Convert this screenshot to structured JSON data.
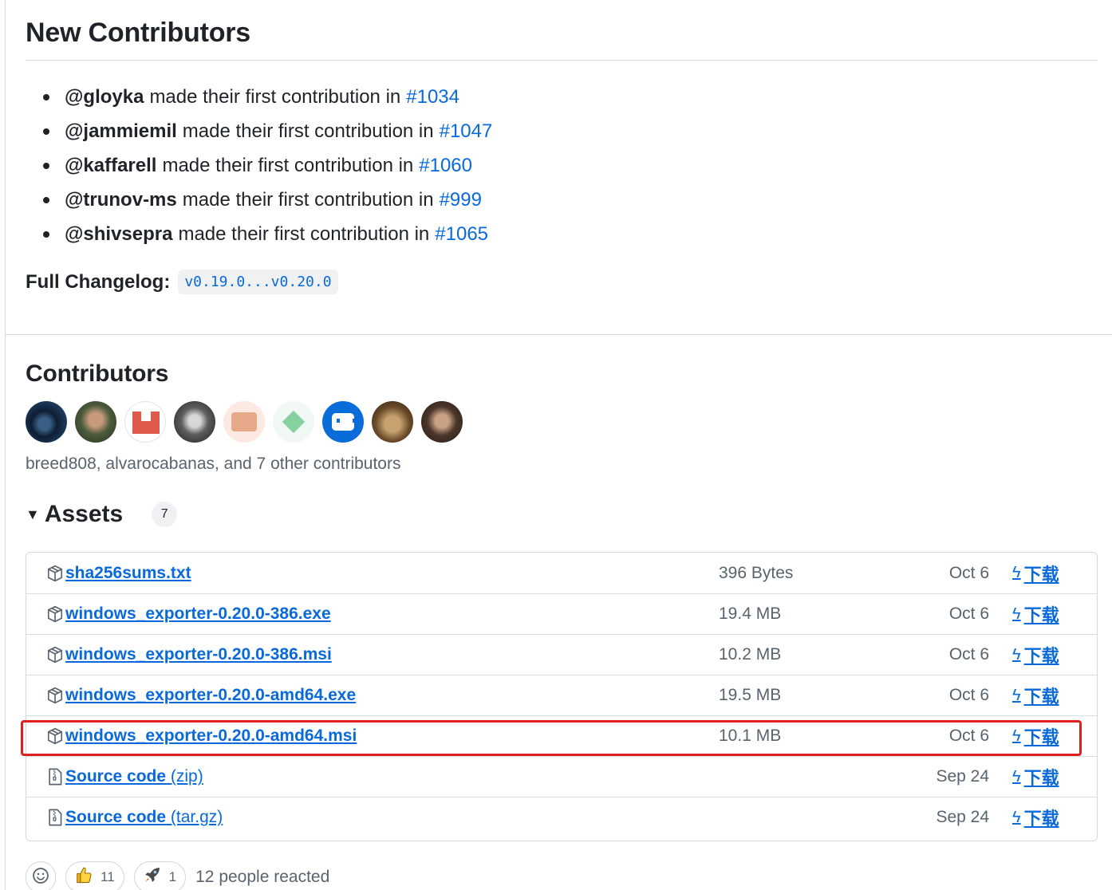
{
  "new_contributors": {
    "title": "New Contributors",
    "items": [
      {
        "user": "@gloyka",
        "text": "made their first contribution in",
        "pr": "#1034"
      },
      {
        "user": "@jammiemil",
        "text": "made their first contribution in",
        "pr": "#1047"
      },
      {
        "user": "@kaffarell",
        "text": "made their first contribution in",
        "pr": "#1060"
      },
      {
        "user": "@trunov-ms",
        "text": "made their first contribution in",
        "pr": "#999"
      },
      {
        "user": "@shivsepra",
        "text": "made their first contribution in",
        "pr": "#1065"
      }
    ]
  },
  "changelog": {
    "label": "Full Changelog:",
    "range": "v0.19.0...v0.20.0"
  },
  "contributors": {
    "title": "Contributors",
    "summary": "breed808, alvarocabanas, and 7 other contributors",
    "avatar_count": 9
  },
  "assets": {
    "title": "Assets",
    "count": "7",
    "download_label": "下载",
    "download_icon": "bolt-icon",
    "rows": [
      {
        "name": "sha256sums.txt",
        "suffix": "",
        "icon": "package-icon",
        "size": "396 Bytes",
        "date": "Oct 6"
      },
      {
        "name": "windows_exporter-0.20.0-386.exe",
        "suffix": "",
        "icon": "package-icon",
        "size": "19.4 MB",
        "date": "Oct 6"
      },
      {
        "name": "windows_exporter-0.20.0-386.msi",
        "suffix": "",
        "icon": "package-icon",
        "size": "10.2 MB",
        "date": "Oct 6"
      },
      {
        "name": "windows_exporter-0.20.0-amd64.exe",
        "suffix": "",
        "icon": "package-icon",
        "size": "19.5 MB",
        "date": "Oct 6"
      },
      {
        "name": "windows_exporter-0.20.0-amd64.msi",
        "suffix": "",
        "icon": "package-icon",
        "size": "10.1 MB",
        "date": "Oct 6",
        "highlighted": true
      },
      {
        "name": "Source code",
        "suffix": "(zip)",
        "icon": "file-zip-icon",
        "size": "",
        "date": "Sep 24"
      },
      {
        "name": "Source code",
        "suffix": "(tar.gz)",
        "icon": "file-zip-icon",
        "size": "",
        "date": "Sep 24"
      }
    ]
  },
  "colors": {
    "link": "#0969da",
    "highlight": "#e02020",
    "muted": "#59636e"
  },
  "reactions": {
    "thumbs_up_count": "11",
    "rocket_count": "1",
    "summary": "12 people reacted"
  }
}
